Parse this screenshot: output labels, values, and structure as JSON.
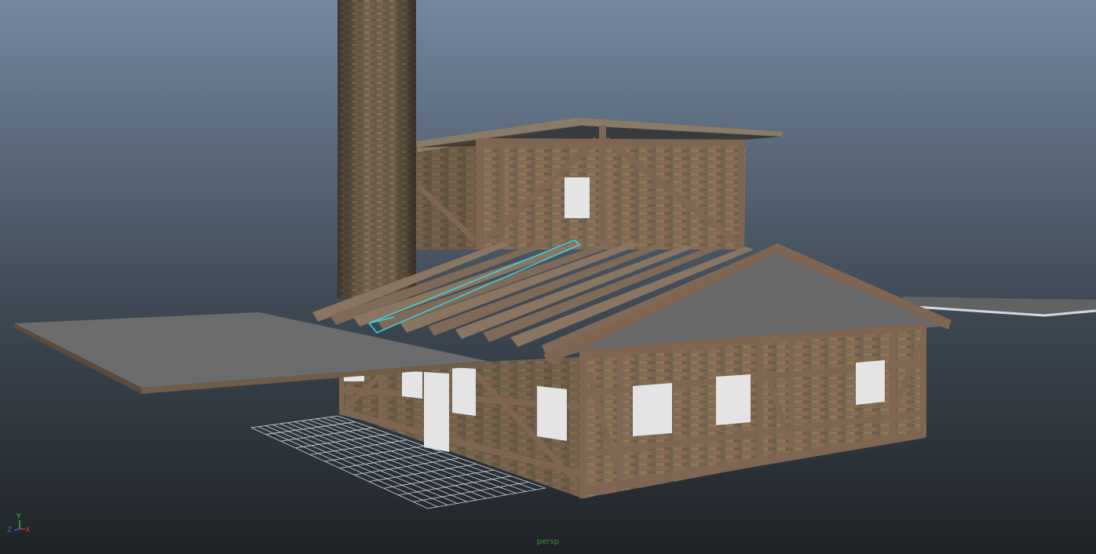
{
  "viewport": {
    "camera_label": "persp",
    "background_top": "#7588a0",
    "background_bottom": "#1f2327"
  },
  "axis_gizmo": {
    "y_label": "Y",
    "x_label": "X",
    "z_label": "Z",
    "y_color": "#3fd24a",
    "x_color": "#e03a3a",
    "z_color": "#3a6ee0"
  },
  "selection": {
    "highlight_color": "#3ad6e6"
  },
  "materials": {
    "brick": "#7d6c55",
    "timber": "#7e6652",
    "roof_gray": "#6a6a6a",
    "window_white": "#e4e4e4",
    "grid_line": "#cfd6dc"
  }
}
